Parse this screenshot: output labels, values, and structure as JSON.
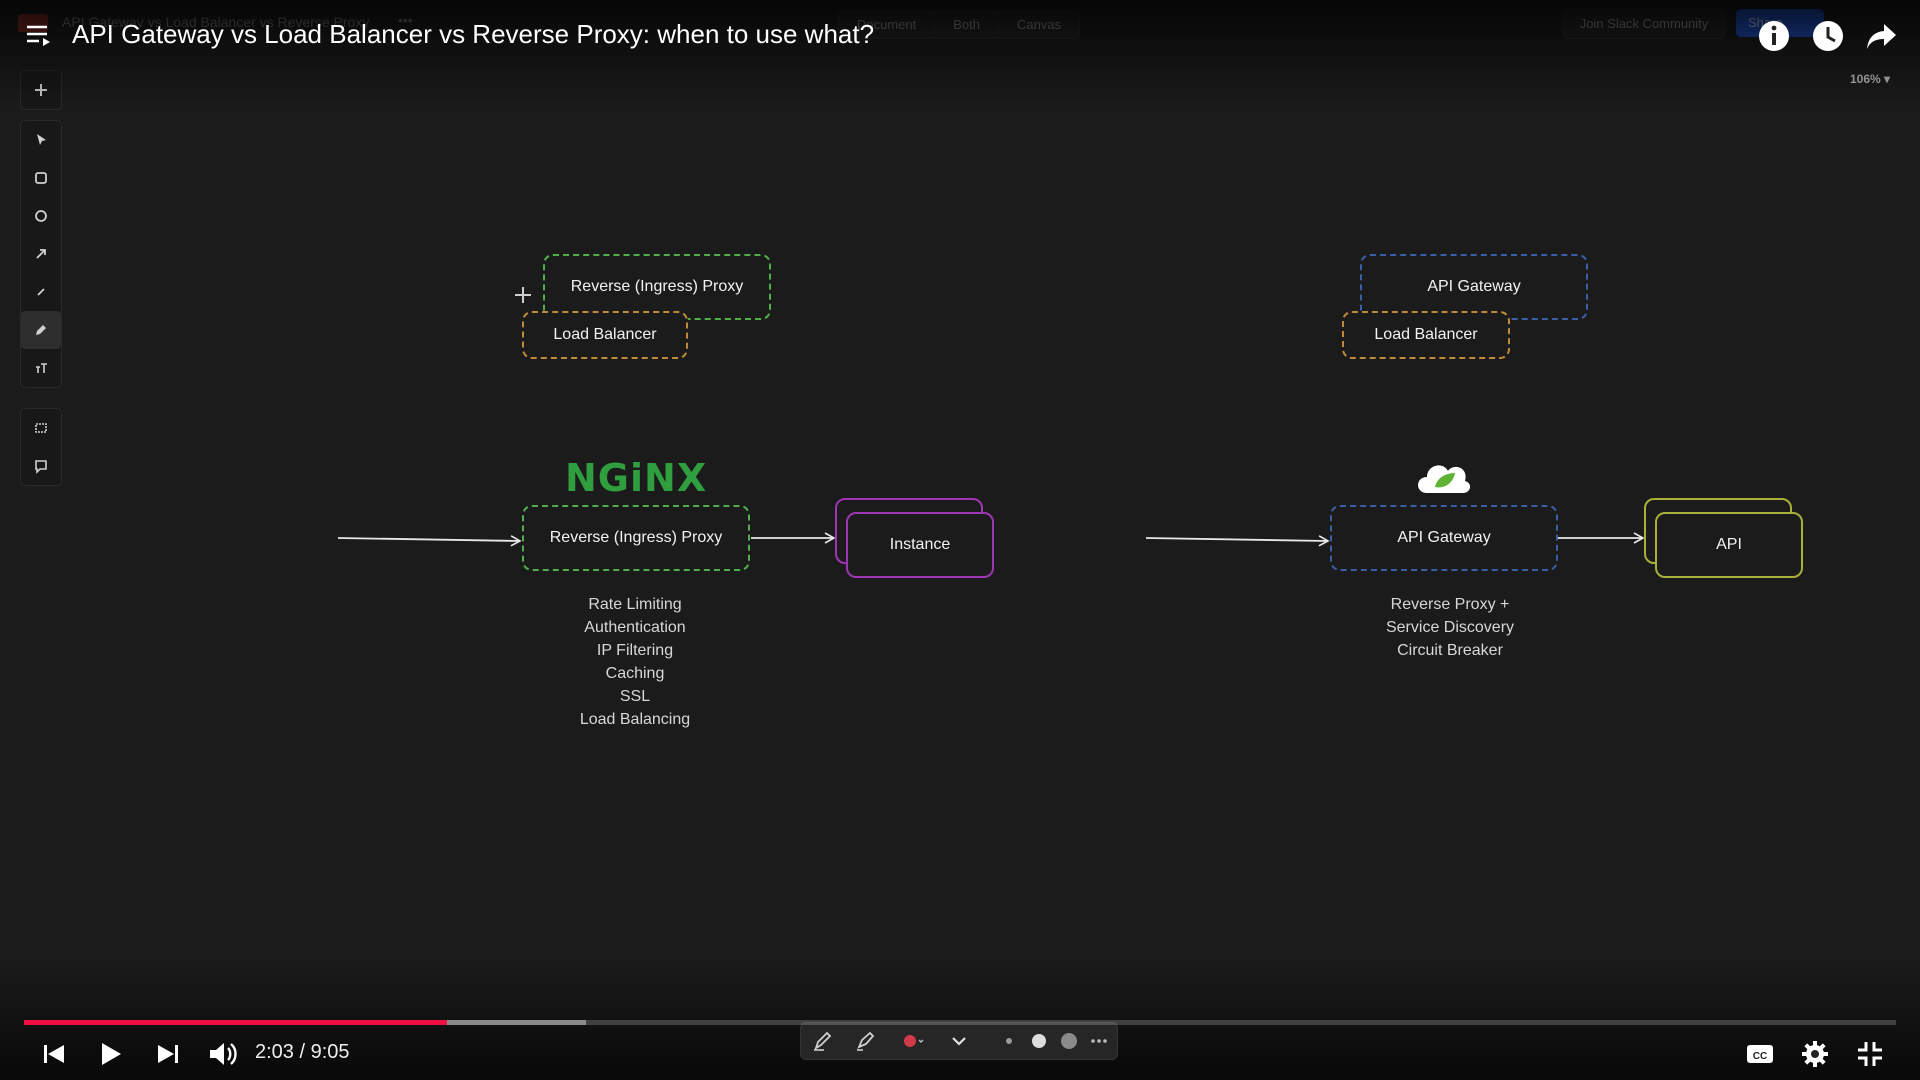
{
  "app": {
    "document_title": "API Gateway vs Load Balancer vs Reverse Proxy",
    "more_label": "•••",
    "view_modes": [
      "Document",
      "Both",
      "Canvas"
    ],
    "join_label": "Join Slack Community",
    "share_label": "Share",
    "zoom": "106% ▾"
  },
  "toolbar": {
    "items": [
      "add-icon",
      "select-icon",
      "rectangle-icon",
      "ellipse-icon",
      "arrow-icon",
      "line-icon",
      "pencil-icon",
      "text-icon",
      "frame-icon",
      "comment-icon"
    ],
    "active": "pencil-icon"
  },
  "diagram": {
    "left_legend": {
      "reverse_proxy": "Reverse (Ingress) Proxy",
      "load_balancer": "Load Balancer"
    },
    "right_legend": {
      "api_gateway": "API Gateway",
      "load_balancer": "Load Balancer"
    },
    "nginx_logo": "NGiNX",
    "left_flow": {
      "proxy": "Reverse (Ingress) Proxy",
      "target": "Instance",
      "features": [
        "Rate Limiting",
        "Authentication",
        "IP Filtering",
        "Caching",
        "SSL",
        "Load Balancing"
      ]
    },
    "right_flow": {
      "gateway": "API Gateway",
      "target": "API",
      "features": [
        "Reverse Proxy +",
        "Service Discovery",
        "Circuit Breaker"
      ]
    },
    "colors": {
      "green": "#4fb04a",
      "orange": "#c08a36",
      "blue": "#3a5fa8",
      "purple": "#a035b4",
      "olive": "#a9b03a"
    }
  },
  "video": {
    "title": "API Gateway vs Load Balancer vs Reverse Proxy: when to use what?",
    "current_time": "2:03",
    "duration": "9:05",
    "time_display": "2:03 / 9:05",
    "played_fraction": 0.226,
    "buffered_fraction": 0.3,
    "accent_color": "#f00f43",
    "top_icons": [
      "info-icon",
      "watch-later-icon",
      "share-icon"
    ],
    "controls": [
      "previous-icon",
      "play-icon",
      "next-icon",
      "volume-icon",
      "captions-icon",
      "settings-icon",
      "exit-fullscreen-icon"
    ]
  },
  "pen_bar": {
    "tools": [
      "pen-icon",
      "highlighter-icon",
      "color-picker-icon",
      "chevron-down-icon",
      "size-small-icon",
      "size-medium-icon",
      "size-large-icon",
      "more-icon"
    ],
    "selected_color": "#d23a4a"
  }
}
